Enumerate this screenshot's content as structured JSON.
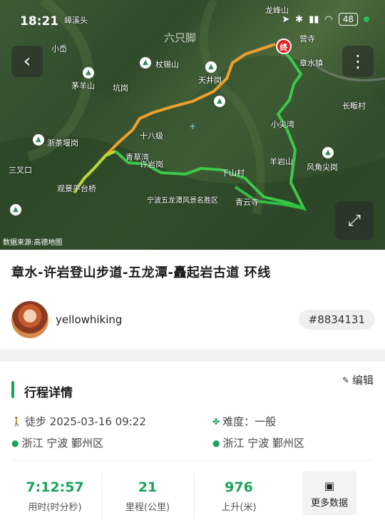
{
  "status_bar": {
    "time": "18:21",
    "battery": "48"
  },
  "map": {
    "watermark": "六只脚",
    "source": "数据来源:高德地图",
    "end_marker": "终",
    "labels": [
      "小岙",
      "章水镇",
      "长畈村",
      "杖锡山",
      "茅羊山",
      "坑岗",
      "天井岗",
      "小尖湾",
      "羊岩山",
      "风角尖岗",
      "浙茶堰岗",
      "三叉口",
      "十八级",
      "青草湾",
      "许岩岗",
      "观景平台桥",
      "宁波五龙潭风景名胜区",
      "青云寺",
      "营寺",
      "龙峰山",
      "下山村",
      "嶂溪头"
    ]
  },
  "buttons": {
    "back": "‹",
    "more": "⋮",
    "expand": "⤢"
  },
  "track": {
    "title": "章水-许岩登山步道-五龙潭-矗起岩古道 环线",
    "author": "yellowhiking",
    "id": "#8834131"
  },
  "details": {
    "heading": "行程详情",
    "edit": "编辑",
    "activity": "徒步 2025-03-16 09:22",
    "difficulty": "难度：一般",
    "start_location": "浙江 宁波 鄞州区",
    "end_location": "浙江 宁波 鄞州区"
  },
  "stats": [
    {
      "value": "7:12:57",
      "label": "用时(时分秒)"
    },
    {
      "value": "21",
      "label": "里程(公里)"
    },
    {
      "value": "976",
      "label": "上升(米)"
    }
  ],
  "more_data": "更多数据",
  "colors": {
    "accent": "#1aa35a",
    "end_marker": "#e0221b"
  }
}
